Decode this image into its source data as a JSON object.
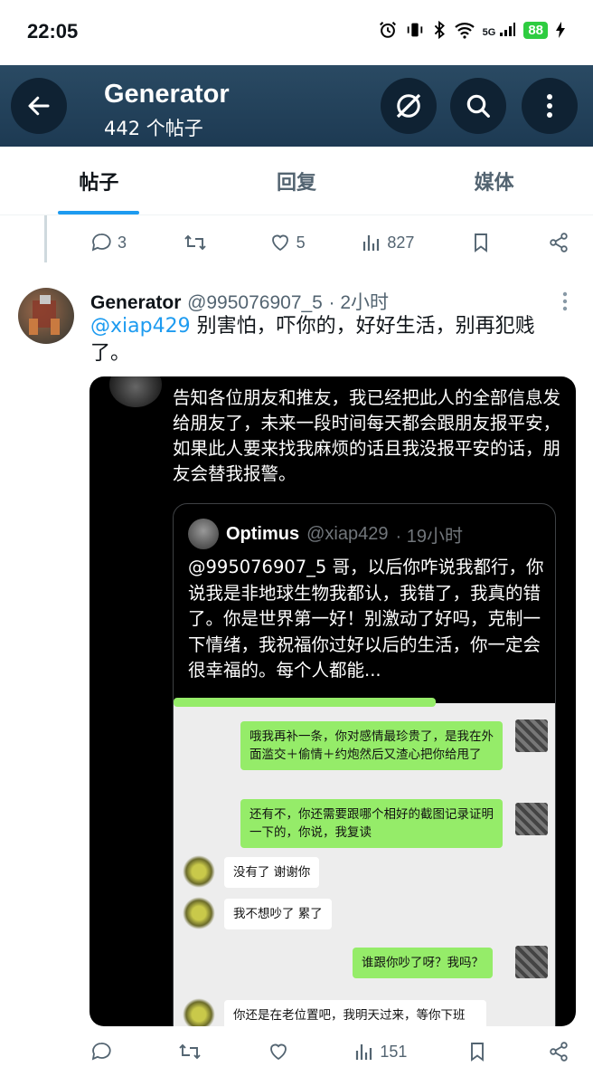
{
  "status_bar": {
    "time": "22:05",
    "network": "5G",
    "battery": "88"
  },
  "header": {
    "title": "Generator",
    "subtitle": "442 个帖子"
  },
  "tabs": [
    {
      "label": "帖子",
      "active": true
    },
    {
      "label": "回复",
      "active": false
    },
    {
      "label": "媒体",
      "active": false
    }
  ],
  "prev_post_actions": {
    "replies": "3",
    "retweets": "",
    "likes": "5",
    "views": "827"
  },
  "post": {
    "author_name": "Generator",
    "author_handle": "@995076907_5",
    "time": "· 2小时",
    "mention": "@xiap429",
    "text": " 别害怕，吓你的，好好生活，别再犯贱了。",
    "media": {
      "quoted_text": "告知各位朋友和推友，我已经把此人的全部信息发给朋友了，未来一段时间每天都会跟朋友报平安，如果此人要来找我麻烦的话且我没报平安的话，朋友会替我报警。",
      "quote_card": {
        "name": "Optimus",
        "handle": "@xiap429",
        "time": "· 19小时",
        "text": "@995076907_5 哥，以后你咋说我都行，你说我是非地球生物我都认，我错了，我真的错了。你是世界第一好！别激动了好吗，克制一下情绪，我祝福你过好以后的生活，你一定会很幸福的。每个人都能..."
      },
      "chat": [
        {
          "side": "right",
          "text": "哦我再补一条，你对感情最珍贵了，是我在外面滥交＋偷情＋约炮然后又渣心把你给甩了"
        },
        {
          "side": "right",
          "text": "还有不，你还需要跟哪个相好的截图记录证明一下的，你说，我复读"
        },
        {
          "side": "left",
          "text": "没有了 谢谢你"
        },
        {
          "side": "left",
          "text": "我不想吵了 累了"
        },
        {
          "side": "right",
          "text": "谁跟你吵了呀？我吗？"
        },
        {
          "side": "left",
          "text": "你还是在老位置吧，我明天过来，等你下班"
        }
      ]
    },
    "actions": {
      "replies": "",
      "retweets": "",
      "likes": "",
      "views": "151"
    }
  }
}
